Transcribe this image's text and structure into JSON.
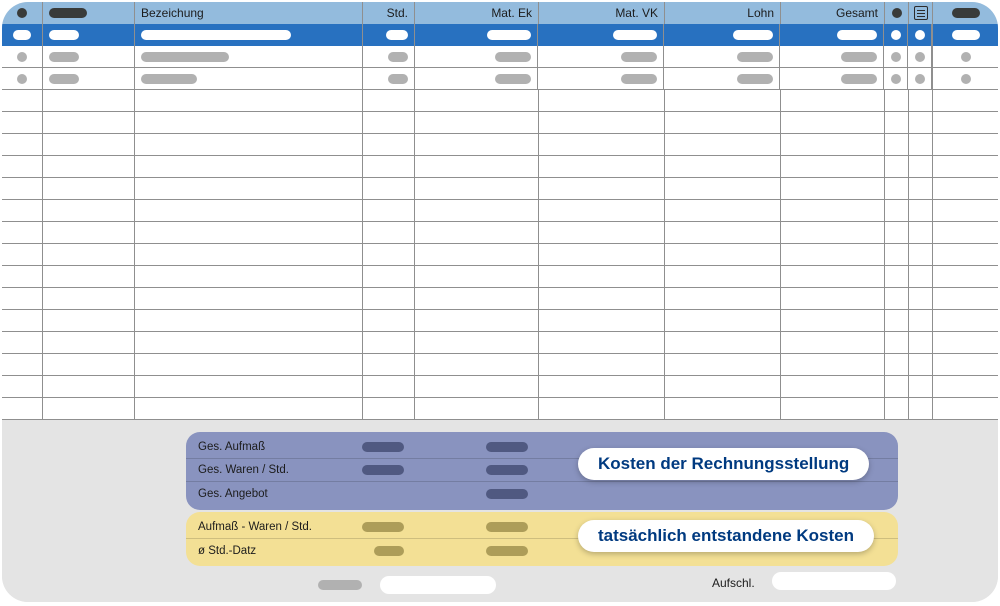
{
  "columns": {
    "bezeichnung": "Bezeichung",
    "std": "Std.",
    "mat_ek": "Mat. Ek",
    "mat_vk": "Mat. VK",
    "lohn": "Lohn",
    "gesamt": "Gesamt"
  },
  "summary": {
    "ges_aufmass": "Ges. Aufmaß",
    "ges_waren_std": "Ges. Waren / Std.",
    "ges_angebot": "Ges. Angebot",
    "aufmass_waren_std": "Aufmaß - Waren / Std.",
    "avg_std_satz": "ø Std.-Datz"
  },
  "callouts": {
    "kosten_rechnung": "Kosten der Rechnungsstellung",
    "tatsaechliche_kosten": "tatsächlich entstandene Kosten"
  },
  "footer": {
    "aufschl": "Aufschl."
  }
}
